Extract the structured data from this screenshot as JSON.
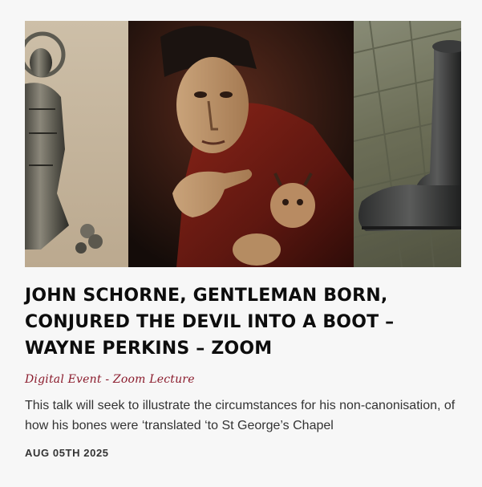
{
  "event": {
    "title": "John Schorne, Gentleman Born, Conjured the Devil into a Boot – Wayne Perkins – Zoom",
    "category": "Digital Event - Zoom Lecture",
    "excerpt": "This talk will seek to illustrate the circumstances for his non-canonisation, of how his bones were ‘translated ‘to St George’s Chapel",
    "date": "Aug 05th 2025"
  },
  "colors": {
    "category": "#8a1a2b",
    "title": "#0d0d0d",
    "background": "#f7f7f7"
  },
  "images": {
    "left": "pilgrim-badge-figure",
    "middle": "carved-figure-holding-devil",
    "right": "boot-on-cobbles"
  }
}
